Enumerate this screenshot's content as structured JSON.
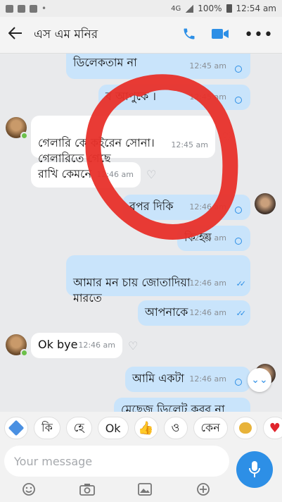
{
  "status_bar": {
    "time": "12:54 am",
    "battery": "100%",
    "network": "4G"
  },
  "header": {
    "back_icon": "back-arrow-icon",
    "contact_name": "এস এম মনির"
  },
  "messages": [
    {
      "side": "out",
      "text": "ডিলেকতাম না",
      "time": "12:45 am",
      "status": "sent"
    },
    {
      "side": "out",
      "text": "ব আপুকে ।",
      "time": "12:45 am",
      "status": "sent"
    },
    {
      "side": "in",
      "text": "গেলারি কে কইরেন সোনা।\nগেলারিতে গেছে",
      "time": "12:45 am"
    },
    {
      "side": "in",
      "text": "রাখি কেমনে",
      "time": "12:46 am"
    },
    {
      "side": "out",
      "text": "বপর দিকি",
      "time": "12:46 am",
      "status": "sent"
    },
    {
      "side": "out",
      "text": "কি হয়",
      "time": "12:46 am",
      "status": "sent"
    },
    {
      "side": "out",
      "text": "আমার মন চায় জোতাদিয়া\nমারতে",
      "time": "12:46 am",
      "status": "read"
    },
    {
      "side": "out",
      "text": "আপনাকে",
      "time": "12:46 am",
      "status": "read"
    },
    {
      "side": "in",
      "text": "Ok bye",
      "time": "12:46 am"
    },
    {
      "side": "out",
      "text": "আমি একটা",
      "time": "12:46 am",
      "status": "sent"
    },
    {
      "side": "out",
      "text": "মেছেজ ডিলেট করব না",
      "time": "",
      "status": ""
    }
  ],
  "suggestions": [
    "কি",
    "হে",
    "Ok",
    "ও",
    "কেন"
  ],
  "composer": {
    "placeholder": "Your message"
  },
  "colors": {
    "accent": "#2d8fe6",
    "outgoing_bubble": "#c9e4fb",
    "incoming_bubble": "#ffffff",
    "scribble": "#e8302a"
  }
}
